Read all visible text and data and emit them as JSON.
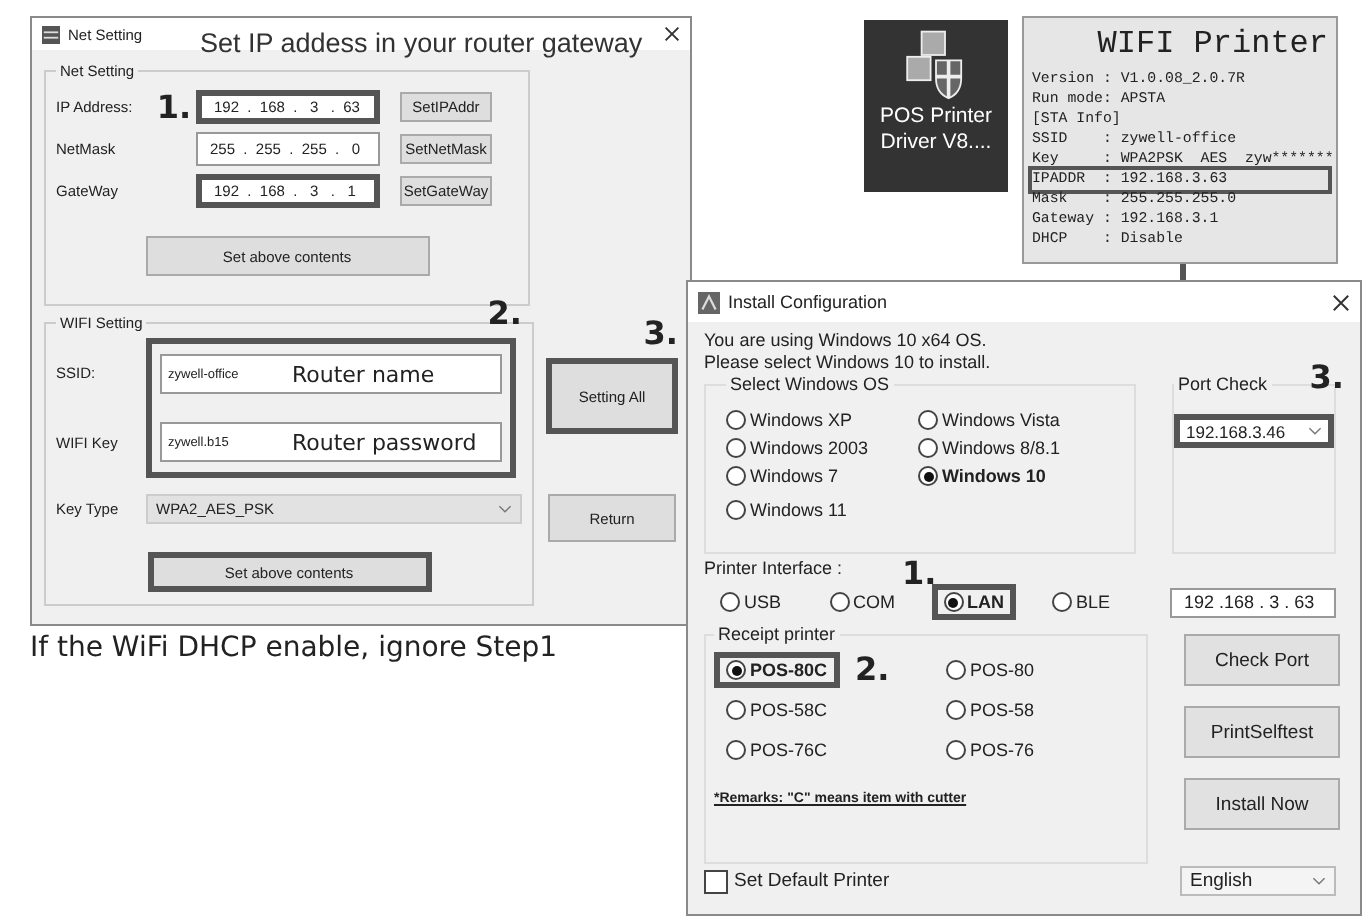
{
  "net_window": {
    "title": "Net Setting",
    "caption": "Set IP addess in your router gateway",
    "net_group": {
      "title": "Net Setting",
      "rows": [
        {
          "label": "IP Address:",
          "value": "192  .  168  .   3   .  63",
          "button": "SetIPAddr",
          "highlighted": true,
          "step": "1."
        },
        {
          "label": "NetMask",
          "value": "255  .  255  .  255  .   0",
          "button": "SetNetMask",
          "highlighted": false
        },
        {
          "label": "GateWay",
          "value": "192  .  168  .   3   .   1",
          "button": "SetGateWay",
          "highlighted": true
        }
      ],
      "set_button": {
        "label": "Set above contents",
        "highlighted": false
      }
    },
    "wifi_group": {
      "title": "WIFI Setting",
      "step": "2.",
      "highlighted": true,
      "fields": [
        {
          "label": "SSID:",
          "value": "zywell-office",
          "annotation": "Router name"
        },
        {
          "label": "WIFI Key",
          "value": "zywell.b15",
          "annotation": "Router password"
        }
      ],
      "key_type": {
        "label": "Key Type",
        "value": "WPA2_AES_PSK"
      },
      "set_button": {
        "label": "Set above contents",
        "highlighted": true
      }
    },
    "setting_all": {
      "label": "Setting All",
      "highlighted": true,
      "step": "3."
    },
    "return_button": {
      "label": "Return",
      "highlighted": false
    }
  },
  "note": "If the WiFi DHCP enable, ignore Step1",
  "desktop_icon": {
    "label": "POS Printer Driver V8...."
  },
  "printout": {
    "title": "WIFI Printer",
    "lines": [
      {
        "text": "Version : V1.0.08_2.0.7R",
        "highlighted": false
      },
      {
        "text": "Run mode: APSTA",
        "highlighted": false
      },
      {
        "text": "[STA Info]",
        "highlighted": false
      },
      {
        "text": "SSID    : zywell-office",
        "highlighted": false
      },
      {
        "text": "Key     : WPA2PSK  AES  zyw*******",
        "highlighted": false
      },
      {
        "text": "IPADDR  : 192.168.3.63",
        "highlighted": true
      },
      {
        "text": "Mask    : 255.255.255.0",
        "highlighted": false
      },
      {
        "text": "Gateway : 192.168.3.1",
        "highlighted": false
      },
      {
        "text": "DHCP    : Disable",
        "highlighted": false
      }
    ]
  },
  "install_window": {
    "title": "Install Configuration",
    "message": [
      "You are using Windows 10 x64 OS.",
      "Please select Windows 10 to install."
    ],
    "os_group": {
      "title": "Select Windows OS",
      "options": [
        {
          "label": "Windows XP",
          "selected": false
        },
        {
          "label": "Windows Vista",
          "selected": false
        },
        {
          "label": "Windows 2003",
          "selected": false
        },
        {
          "label": "Windows 8/8.1",
          "selected": false
        },
        {
          "label": "Windows 7",
          "selected": false
        },
        {
          "label": "Windows 10",
          "selected": true
        },
        {
          "label": "Windows 11",
          "selected": false
        }
      ]
    },
    "port_check": {
      "title": "Port Check",
      "value": "192.168.3.46",
      "step": "3.",
      "highlighted": true
    },
    "interface": {
      "label": "Printer Interface :",
      "step": "1.",
      "ip": "192 .168 . 3 . 63",
      "options": [
        {
          "label": "USB",
          "selected": false,
          "highlighted": false
        },
        {
          "label": "COM",
          "selected": false,
          "highlighted": false
        },
        {
          "label": "LAN",
          "selected": true,
          "highlighted": true
        },
        {
          "label": "BLE",
          "selected": false,
          "highlighted": false
        }
      ]
    },
    "receipt_group": {
      "title": "Receipt printer",
      "step": "2.",
      "remark": "*Remarks: \"C\" means item with cutter",
      "options": [
        {
          "label": "POS-80C",
          "selected": true,
          "highlighted": true
        },
        {
          "label": "POS-80",
          "selected": false,
          "highlighted": false
        },
        {
          "label": "POS-58C",
          "selected": false,
          "highlighted": false
        },
        {
          "label": "POS-58",
          "selected": false,
          "highlighted": false
        },
        {
          "label": "POS-76C",
          "selected": false,
          "highlighted": false
        },
        {
          "label": "POS-76",
          "selected": false,
          "highlighted": false
        }
      ]
    },
    "buttons": [
      "Check Port",
      "PrintSelftest",
      "Install Now"
    ],
    "language": "English",
    "default_printer": {
      "label": "Set Default Printer",
      "checked": false
    }
  }
}
